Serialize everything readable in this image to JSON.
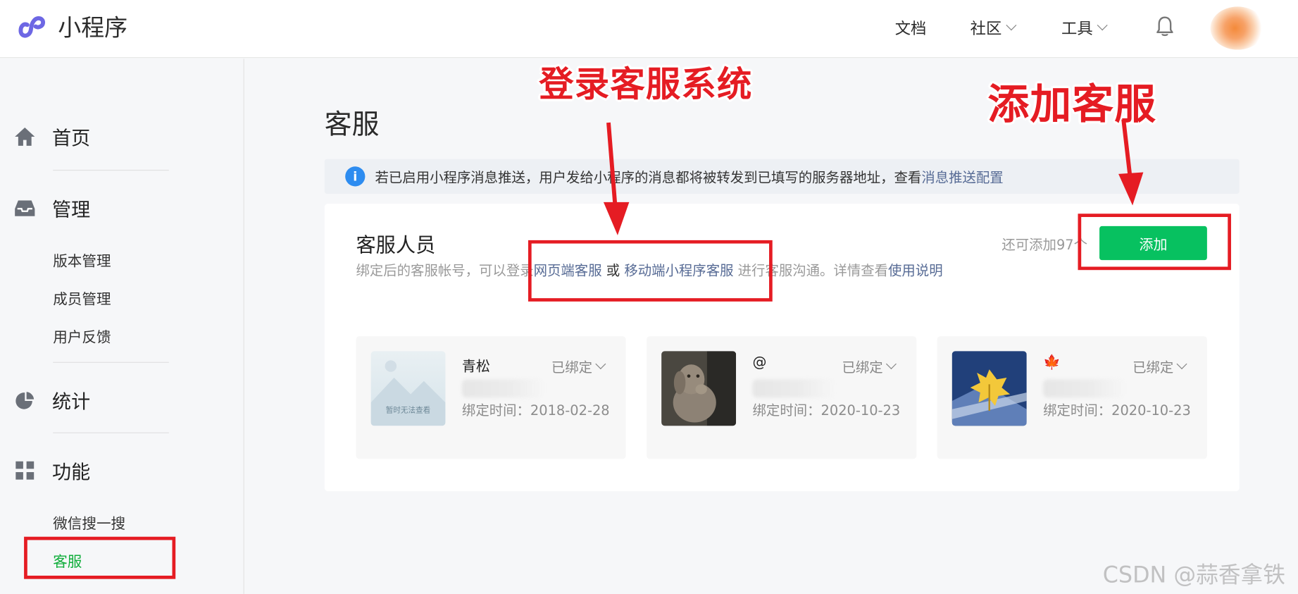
{
  "header": {
    "app_title": "小程序",
    "nav": [
      {
        "label": "文档",
        "has_dropdown": false
      },
      {
        "label": "社区",
        "has_dropdown": true
      },
      {
        "label": "工具",
        "has_dropdown": true
      }
    ],
    "icons": [
      "miniprogram-logo-icon",
      "bell-icon",
      "user-avatar"
    ]
  },
  "sidebar": {
    "sections": [
      {
        "label": "首页",
        "icon": "home-icon"
      },
      {
        "label": "管理",
        "icon": "inbox-icon",
        "items": [
          "版本管理",
          "成员管理",
          "用户反馈"
        ]
      },
      {
        "label": "统计",
        "icon": "pie-chart-icon"
      },
      {
        "label": "功能",
        "icon": "grid-icon",
        "items": [
          "微信搜一搜",
          "客服"
        ],
        "active_item": "客服"
      }
    ]
  },
  "main": {
    "title": "客服",
    "notice": {
      "text": "若已启用小程序消息推送，用户发给小程序的消息都将被转发到已填写的服务器地址，查看 ",
      "link": "消息推送配置"
    },
    "card": {
      "title": "客服人员",
      "desc_prefix": "绑定后的客服帐号，可以登录",
      "web_link": "网页端客服",
      "or": " 或 ",
      "mobile_link": "移动端小程序客服",
      "desc_middle": " 进行客服沟通。详情查看",
      "guide_link": "使用说明",
      "remaining": "还可添加97个",
      "add_button": "添加",
      "agents": [
        {
          "name": "青松",
          "status": "已绑定",
          "bind_time": "绑定时间：2018-02-28",
          "avatar": "placeholder-image",
          "placeholder_text": "暂时无法查看"
        },
        {
          "name": "@",
          "status": "已绑定",
          "bind_time": "绑定时间：2020-10-23",
          "avatar": "dog-photo"
        },
        {
          "name": "🍁",
          "status": "已绑定",
          "bind_time": "绑定时间：2020-10-23",
          "avatar": "leaf-photo"
        }
      ]
    }
  },
  "annotations": {
    "login_label": "登录客服系统",
    "add_label": "添加客服",
    "color": "#e51c23"
  },
  "watermark": "CSDN @蒜香拿铁",
  "colors": {
    "accent_green": "#07c160",
    "link_blue": "#576b95",
    "sidebar_active": "#0fad3a"
  }
}
